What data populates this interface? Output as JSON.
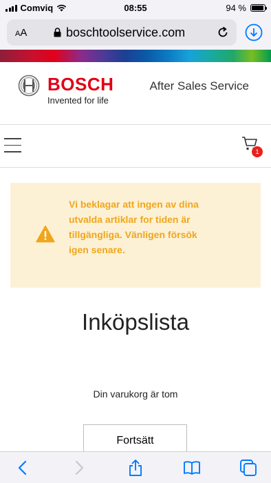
{
  "status": {
    "carrier": "Comviq",
    "time": "08:55",
    "battery": "94 %",
    "battery_level": 0.94
  },
  "browser": {
    "text_size_label": "AA",
    "url": "boschtoolservice.com"
  },
  "header": {
    "brand": "BOSCH",
    "tagline": "Invented for life",
    "section": "After Sales Service"
  },
  "nav": {
    "cart_count": "1"
  },
  "alert": {
    "message": "Vi beklagar att ingen av dina utvalda artiklar for tiden är tillgängliga. Vänligen försök igen senare."
  },
  "main": {
    "title": "Inköpslista",
    "empty_message": "Din varukorg är tom",
    "continue_label": "Fortsätt"
  },
  "colors": {
    "brand_red": "#e20015",
    "alert_bg": "#fdf1d5",
    "alert_text": "#f0a61c",
    "ios_blue": "#007aff",
    "badge_red": "#e8211c"
  },
  "toolbar": {
    "icons": [
      "back-icon",
      "forward-icon",
      "share-icon",
      "bookmarks-icon",
      "tabs-icon"
    ]
  }
}
